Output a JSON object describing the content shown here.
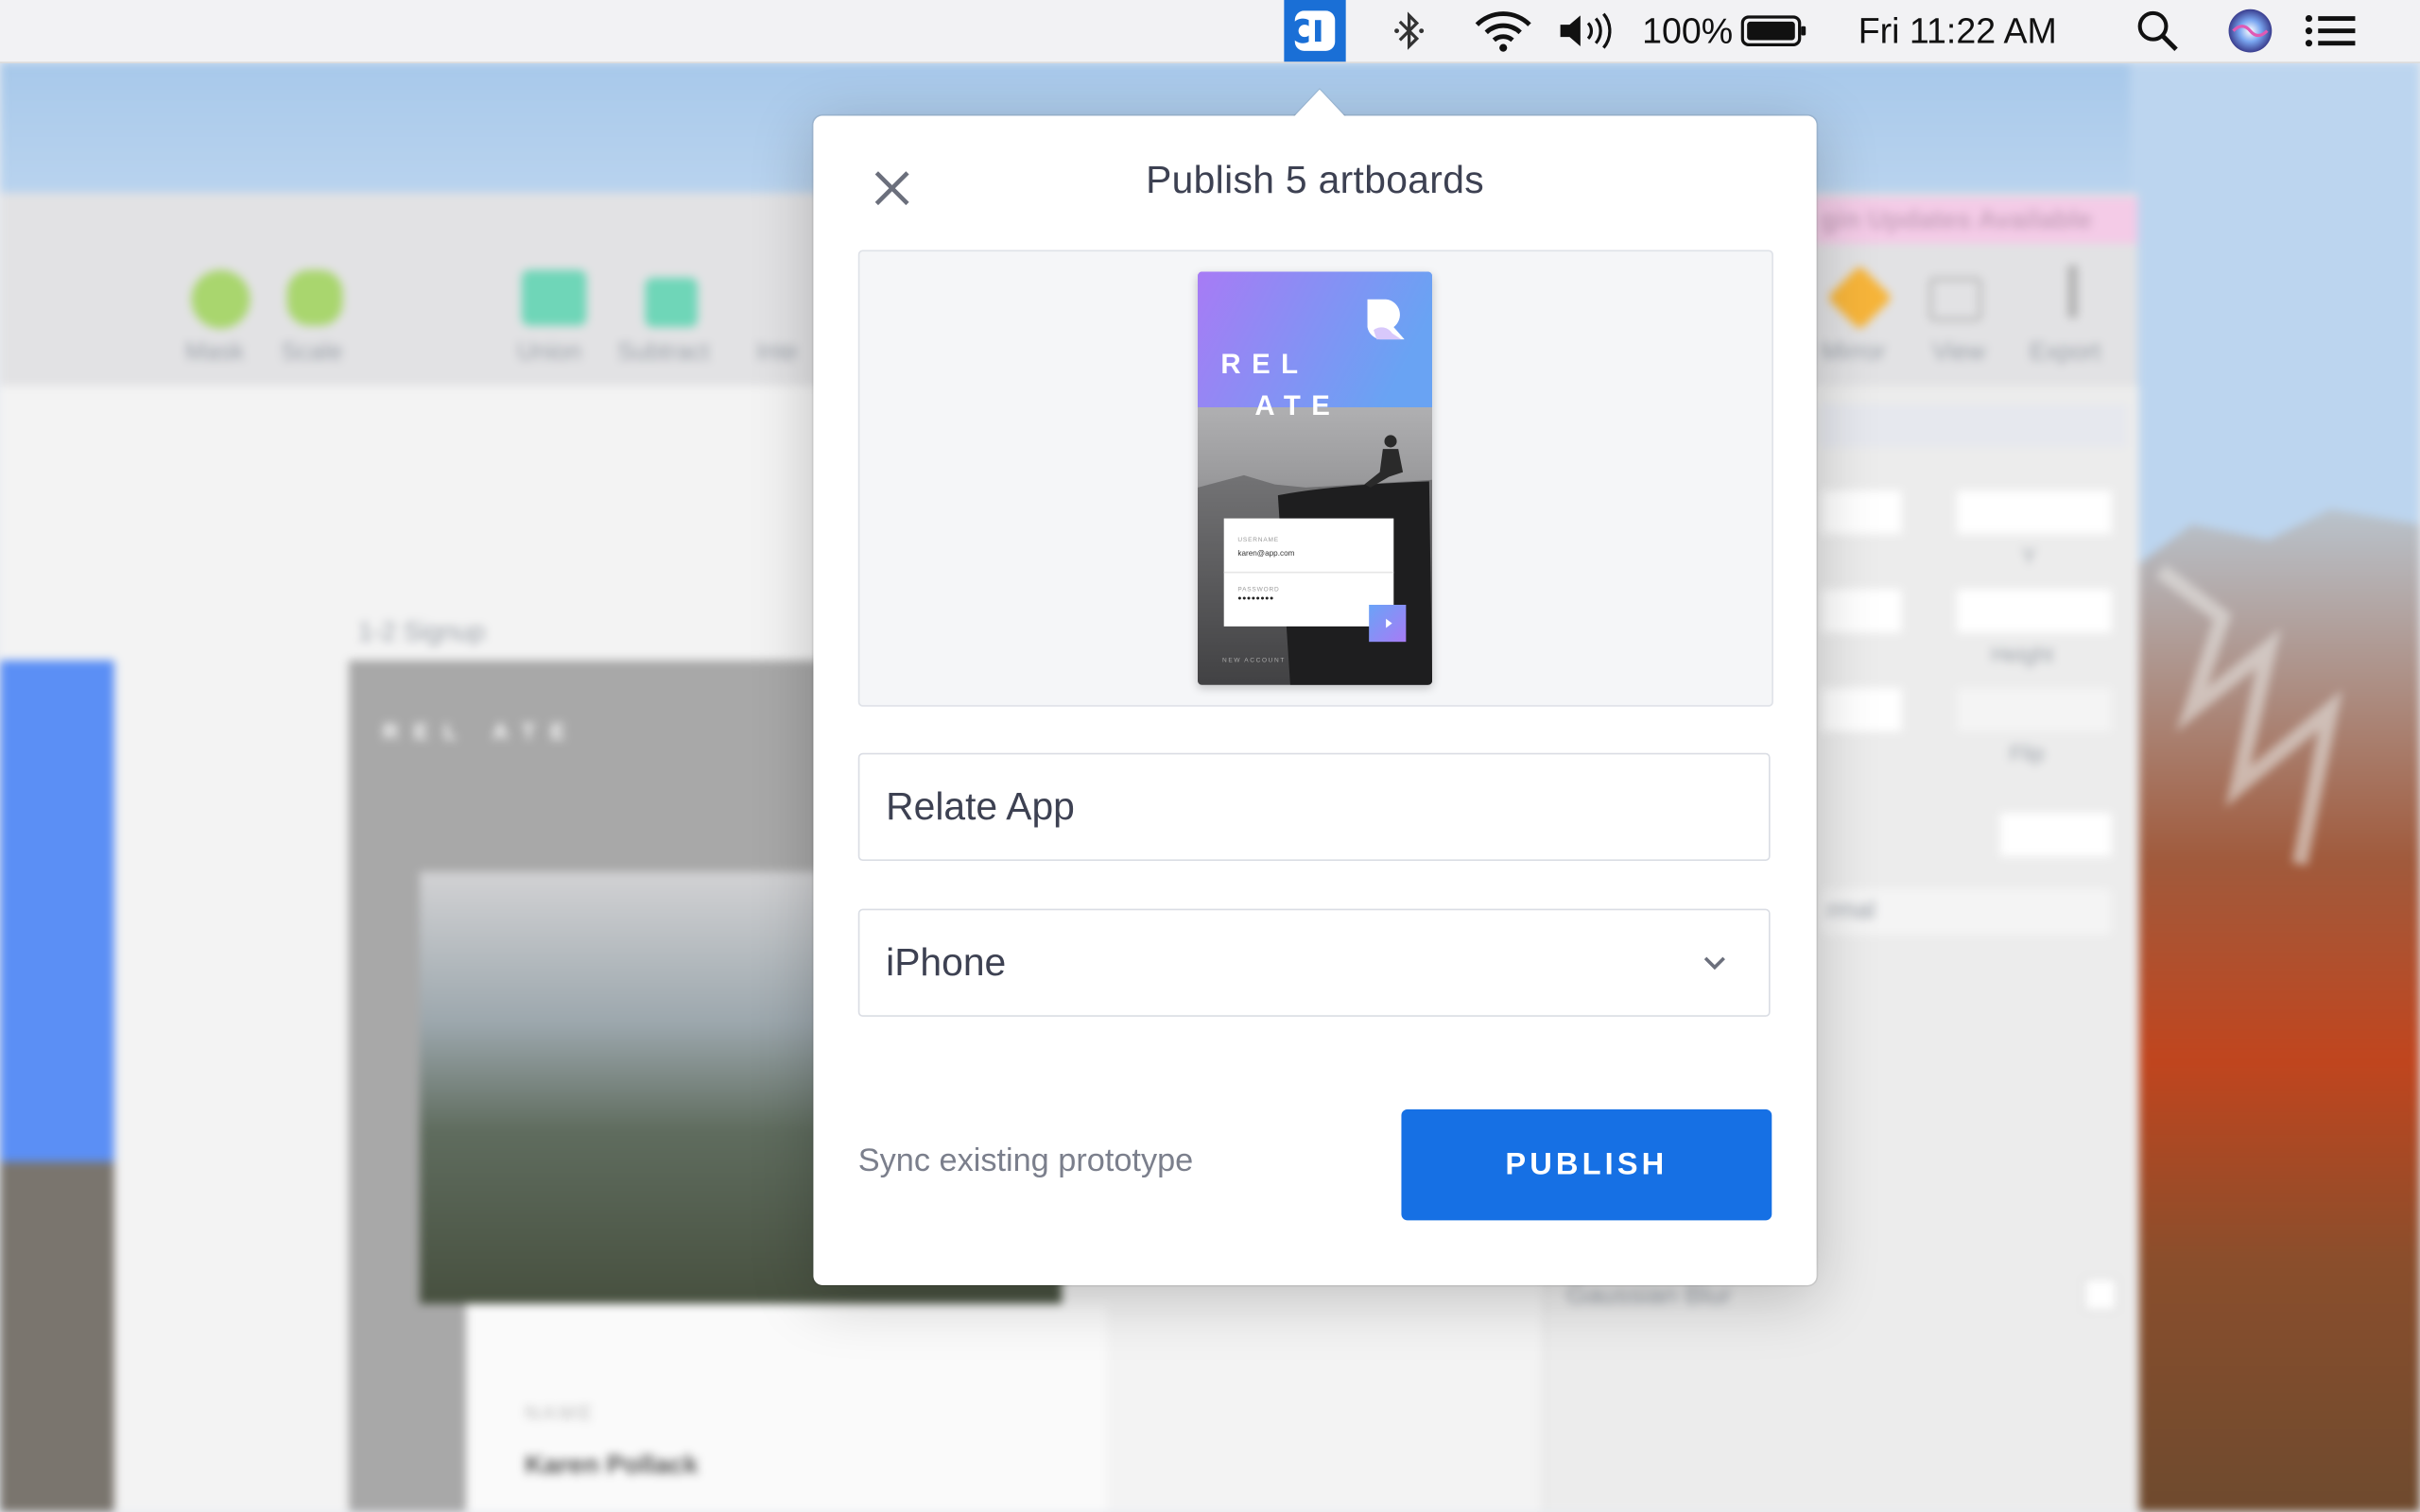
{
  "menubar": {
    "battery_percent": "100%",
    "clock": "Fri 11:22 AM",
    "icons": [
      "app-logo-icon",
      "bluetooth-icon",
      "wifi-icon",
      "volume-icon",
      "battery-icon",
      "search-icon",
      "siri-icon",
      "list-icon"
    ]
  },
  "background": {
    "toolbar_labels": [
      "Mask",
      "Scale",
      "Union",
      "Subtract",
      "Inte",
      "Mirror",
      "View",
      "Export"
    ],
    "plugin_banner": "gin Updates Available",
    "artboard_label": "1-2 Signup",
    "artboard_logo": "REL ATE",
    "name_label": "NAME",
    "name_value": "Karen Pollack",
    "inspector_labels": [
      "Y",
      "Height",
      "Flip"
    ],
    "blend_label": "Gaussian Blur",
    "blend_select": "rmal"
  },
  "dialog": {
    "title": "Publish 5 artboards",
    "project_name_value": "Relate App",
    "device_selected": "iPhone",
    "sync_link": "Sync existing prototype",
    "publish_label": "PUBLISH"
  },
  "preview": {
    "logo_line1": "REL",
    "logo_line2": "ATE",
    "username_label": "USERNAME",
    "username_value": "karen@app.com",
    "password_label": "PASSWORD",
    "password_value": "••••••••",
    "new_account": "NEW ACCOUNT"
  },
  "colors": {
    "accent": "#1670e4",
    "menubar_app_icon_bg": "#1a6fd6",
    "dialog_text": "#3d4152",
    "secondary_text": "#7b7f8c"
  }
}
